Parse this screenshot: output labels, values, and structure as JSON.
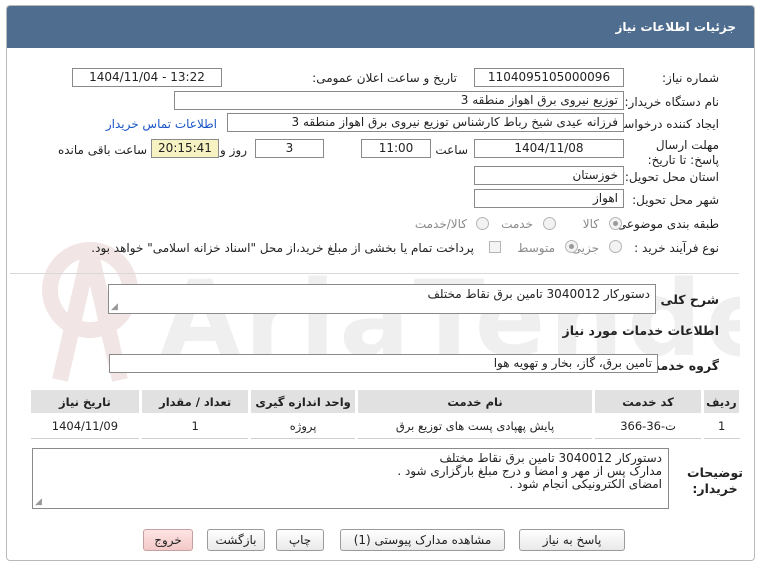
{
  "header": {
    "title": "جزئیات اطلاعات نیاز"
  },
  "fields": {
    "need_number_label": "شماره نیاز:",
    "need_number": "1104095105000096",
    "announce_label": "تاریخ و ساعت اعلان عمومی:",
    "announce_value": "1404/11/04 - 13:22",
    "buyer_org_label": "نام دستگاه خریدار:",
    "buyer_org": "توزیع نیروی برق اهواز منطقه 3",
    "creator_label": "ایجاد کننده درخواست:",
    "creator": "فرزانه عیدی شیخ رباط کارشناس توزیع نیروی برق اهواز منطقه 3",
    "contact_link": "اطلاعات تماس خریدار",
    "deadline_label": "مهلت ارسال پاسخ: تا تاریخ:",
    "deadline_date": "1404/11/08",
    "time_label": "ساعت",
    "deadline_time": "11:00",
    "days_value": "3",
    "days_label": "روز و",
    "remaining_time": "20:15:41",
    "remaining_label": "ساعت باقی مانده",
    "province_label": "استان محل تحویل:",
    "province": "خوزستان",
    "city_label": "شهر محل تحویل:",
    "city": "اهواز",
    "category_label": "طبقه بندی موضوعی:",
    "category_options": [
      "کالا",
      "خدمت",
      "کالا/خدمت"
    ],
    "process_label": "نوع فرآیند خرید :",
    "process_options": [
      "جزیی",
      "متوسط"
    ],
    "payment_note": "پرداخت تمام یا بخشی از مبلغ خرید،از محل \"اسناد خزانه اسلامی\" خواهد بود."
  },
  "summary": {
    "label": "شرح کلی نیاز:",
    "value": "دستورکار 3040012 تامین برق نقاط مختلف"
  },
  "services": {
    "section_title": "اطلاعات خدمات مورد نیاز",
    "group_label": "گروه خدمت:",
    "group_value": "تامین برق، گاز، بخار و تهویه هوا",
    "columns": [
      "ردیف",
      "کد خدمت",
      "نام خدمت",
      "واحد اندازه گیری",
      "تعداد / مقدار",
      "تاریخ نیاز"
    ],
    "rows": [
      [
        "1",
        "ت-36-366",
        "پایش پهپادی پست های توزیع برق",
        "پروژه",
        "1",
        "1404/11/09"
      ]
    ]
  },
  "buyer_notes": {
    "label_line1": "توضیحات",
    "label_line2": "خریدار:",
    "lines": [
      "دستورکار 3040012 تامین برق نقاط مختلف",
      "مدارک پس از مهر و امضا و درج مبلغ بارگزاری شود .",
      "امضای الکترونیکی انجام شود ."
    ]
  },
  "buttons": {
    "reply": "پاسخ به نیاز",
    "view_docs": "مشاهده مدارک پیوستی (1)",
    "print": "چاپ",
    "back": "بازگشت",
    "exit": "خروج"
  },
  "colors": {
    "header_bg": "#4f6d8f",
    "link": "#1a56c7",
    "remaining_bg": "#f6f2c2",
    "exit_button_bg": "#f3c9c9"
  }
}
